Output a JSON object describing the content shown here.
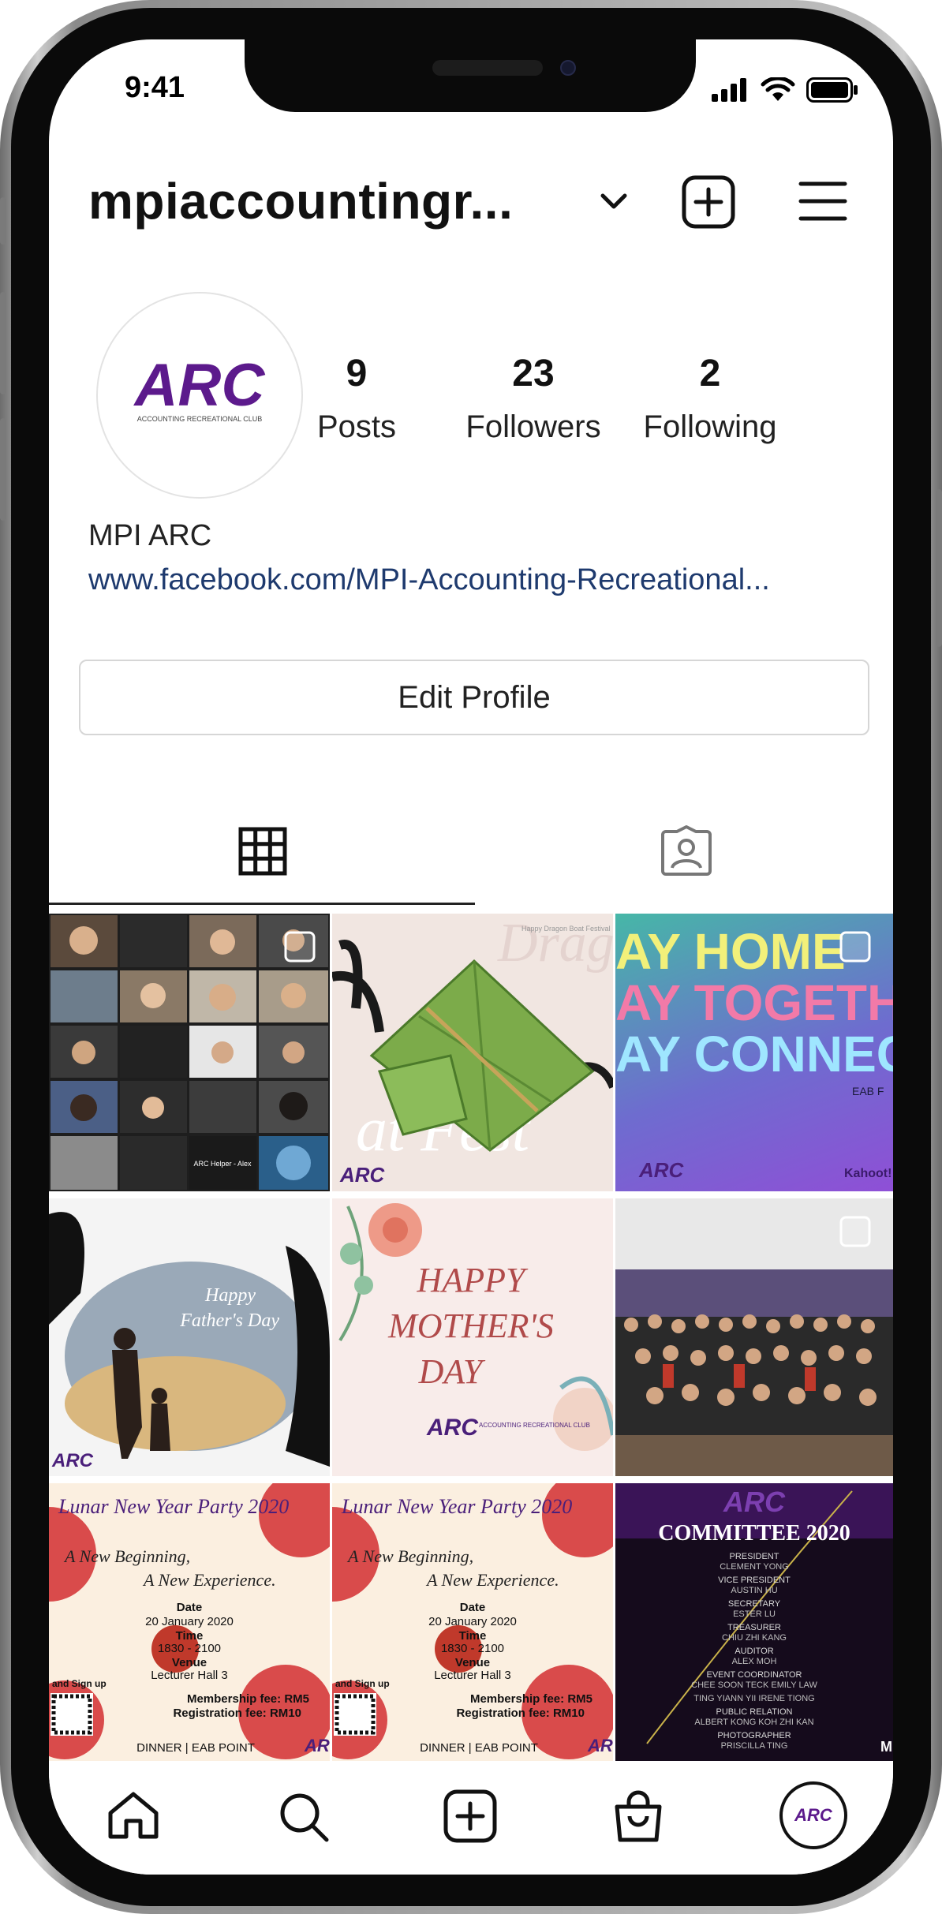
{
  "status_bar": {
    "time": "9:41"
  },
  "header": {
    "username": "mpiaccountingr..."
  },
  "profile": {
    "avatar_logo": "ARC",
    "avatar_subtitle": "ACCOUNTING RECREATIONAL CLUB",
    "stats": [
      {
        "value": "9",
        "label": "Posts"
      },
      {
        "value": "23",
        "label": "Followers"
      },
      {
        "value": "2",
        "label": "Following"
      }
    ],
    "name": "MPI ARC",
    "link": "www.facebook.com/MPI-Accounting-Recreational..."
  },
  "edit_button": {
    "label": "Edit Profile"
  },
  "tabs": [
    {
      "icon": "grid-icon",
      "active": true
    },
    {
      "icon": "tagged-icon",
      "active": false
    }
  ],
  "posts": [
    {
      "kind": "video-call-collage",
      "caption": "ARC Helper - Alex"
    },
    {
      "kind": "dragon-boat-festival",
      "caption": "Happy Dragon Boat Festival",
      "watermark": "ARC"
    },
    {
      "kind": "stay-home",
      "lines": [
        "AY HOME",
        "AY TOGETH",
        "AY CONNEC"
      ],
      "tag": "EAB F",
      "brand": "Kahoot!",
      "watermark": "ARC"
    },
    {
      "kind": "fathers-day",
      "caption_line1": "Happy",
      "caption_line2": "Father's Day",
      "watermark": "ARC"
    },
    {
      "kind": "mothers-day",
      "lines": [
        "HAPPY",
        "MOTHER'S",
        "DAY"
      ],
      "logo": "ARC",
      "logo_sub": "ACCOUNTING RECREATIONAL CLUB"
    },
    {
      "kind": "group-photo"
    },
    {
      "kind": "lunar-new-year",
      "title": "Lunar New Year Party 2020",
      "tagline1": "A New Beginning,",
      "tagline2": "A New Experience.",
      "date_label": "Date",
      "date": "20 January 2020",
      "time_label": "Time",
      "time": "1830 - 2100",
      "venue_label": "Venue",
      "venue": "Lecturer Hall 3",
      "signup": "and Sign up",
      "membership_fee": "Membership fee: RM5",
      "registration_fee": "Registration fee: RM10",
      "footer": "DINNER | EAB POINT",
      "corner": "AR"
    },
    {
      "kind": "lunar-new-year",
      "title": "Lunar New Year Party 2020",
      "tagline1": "A New Beginning,",
      "tagline2": "A New Experience.",
      "date_label": "Date",
      "date": "20 January 2020",
      "time_label": "Time",
      "time": "1830 - 2100",
      "venue_label": "Venue",
      "venue": "Lecturer Hall 3",
      "signup": "and Sign up",
      "membership_fee": "Membership fee: RM5",
      "registration_fee": "Registration fee: RM10",
      "footer": "DINNER | EAB POINT",
      "corner": "AR"
    },
    {
      "kind": "committee",
      "logo": "ARC",
      "title": "COMMITTEE 2020",
      "roles": [
        [
          "PRESIDENT",
          "CLEMENT YONG"
        ],
        [
          "VICE PRESIDENT",
          "AUSTIN HU"
        ],
        [
          "SECRETARY",
          "ESTER LU"
        ],
        [
          "TREASURER",
          "CHIU ZHI KANG"
        ],
        [
          "AUDITOR",
          "ALEX MOH"
        ],
        [
          "EVENT COORDINATOR",
          "CHEE SOON TECK   EMILY LAW"
        ],
        [
          "",
          "TING YIANN YII   IRENE TIONG"
        ],
        [
          "PUBLIC RELATION",
          "ALBERT KONG   KOH ZHI KAN"
        ],
        [
          "PHOTOGRAPHER",
          "PRISCILLA TING"
        ]
      ],
      "corner": "M"
    }
  ],
  "bottom_nav": [
    {
      "icon": "home-icon"
    },
    {
      "icon": "search-icon"
    },
    {
      "icon": "new-post-icon"
    },
    {
      "icon": "shop-icon"
    },
    {
      "icon": "profile-avatar",
      "label": "ARC"
    }
  ]
}
